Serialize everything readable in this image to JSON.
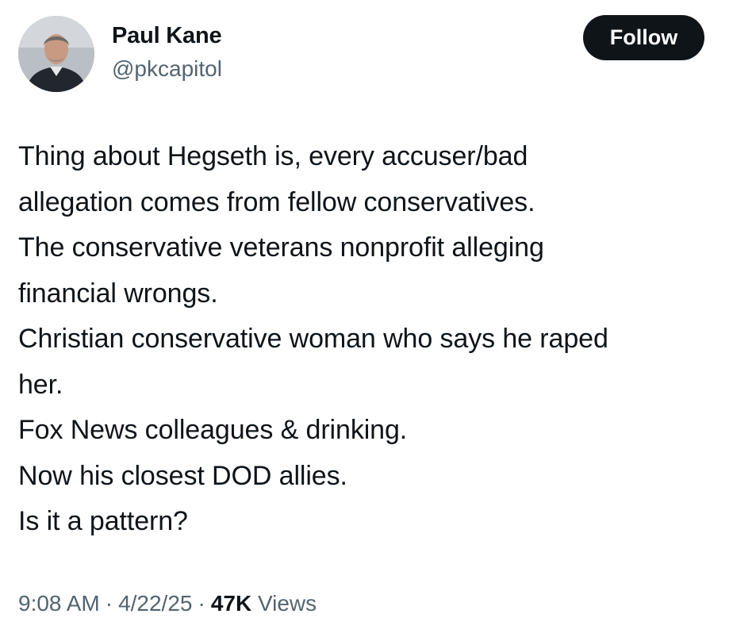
{
  "author": {
    "display_name": "Paul Kane",
    "handle": "@pkcapitol"
  },
  "follow_button": {
    "label": "Follow"
  },
  "tweet": {
    "lines": [
      "Thing about Hegseth is, every accuser/bad",
      "allegation comes from fellow conservatives.",
      "The conservative veterans nonprofit alleging",
      "financial wrongs.",
      "Christian conservative woman who says he raped",
      "her.",
      "Fox News colleagues & drinking.",
      "Now his closest DOD allies.",
      "Is it a pattern?"
    ]
  },
  "meta": {
    "time": "9:08 AM",
    "date": "4/22/25",
    "separator": "·",
    "views_count": "47K",
    "views_label": "Views"
  },
  "colors": {
    "text_primary": "#0f1419",
    "text_secondary": "#536471",
    "button_bg": "#0f1419",
    "button_text": "#ffffff",
    "background": "#ffffff"
  }
}
